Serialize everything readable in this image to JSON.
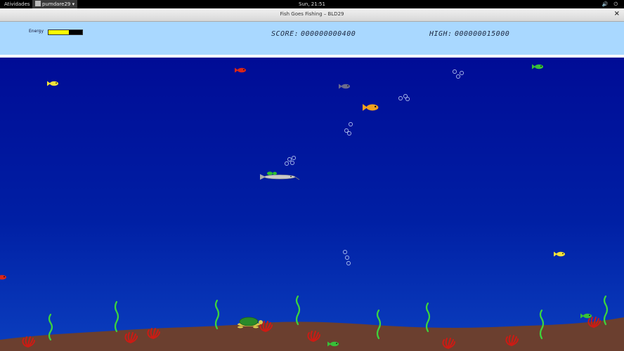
{
  "topbar": {
    "activities": "Atividades",
    "app_name": "pumdare29",
    "clock": "Sun, 21:51"
  },
  "window": {
    "title": "Fish Goes Fishing – BLD29",
    "close_glyph": "×"
  },
  "hud": {
    "energy_label": "Energy",
    "energy_level": 0.6,
    "score_label": "SCORE:",
    "score_value": "000000000400",
    "high_label": "HIGH:",
    "high_value": "000000015000"
  },
  "colors": {
    "hud_bg": "#a9d8ff",
    "energy": "#ffff00",
    "ocean_top": "#000c96",
    "ocean_bottom": "#0b3fbf",
    "seabed": "#6b3f2f",
    "seaweed": "#3dd43d",
    "anemone": "#cc1b14"
  }
}
